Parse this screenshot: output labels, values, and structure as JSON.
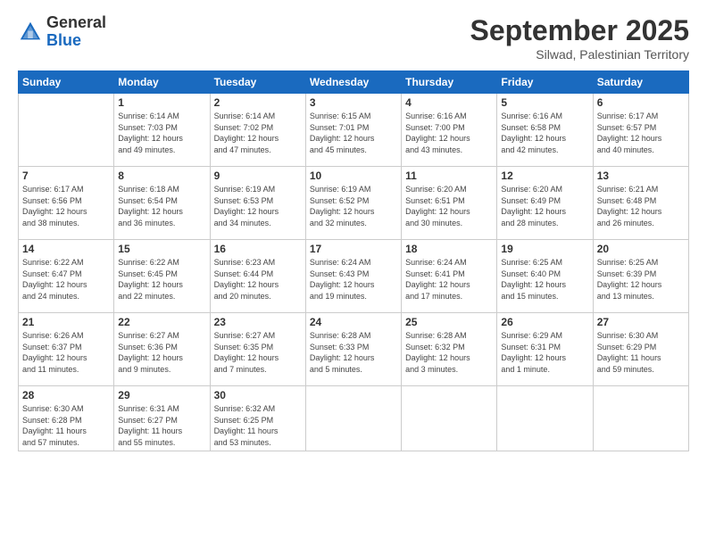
{
  "logo": {
    "general": "General",
    "blue": "Blue"
  },
  "header": {
    "month": "September 2025",
    "location": "Silwad, Palestinian Territory"
  },
  "days_of_week": [
    "Sunday",
    "Monday",
    "Tuesday",
    "Wednesday",
    "Thursday",
    "Friday",
    "Saturday"
  ],
  "weeks": [
    [
      {
        "day": "",
        "info": ""
      },
      {
        "day": "1",
        "info": "Sunrise: 6:14 AM\nSunset: 7:03 PM\nDaylight: 12 hours\nand 49 minutes."
      },
      {
        "day": "2",
        "info": "Sunrise: 6:14 AM\nSunset: 7:02 PM\nDaylight: 12 hours\nand 47 minutes."
      },
      {
        "day": "3",
        "info": "Sunrise: 6:15 AM\nSunset: 7:01 PM\nDaylight: 12 hours\nand 45 minutes."
      },
      {
        "day": "4",
        "info": "Sunrise: 6:16 AM\nSunset: 7:00 PM\nDaylight: 12 hours\nand 43 minutes."
      },
      {
        "day": "5",
        "info": "Sunrise: 6:16 AM\nSunset: 6:58 PM\nDaylight: 12 hours\nand 42 minutes."
      },
      {
        "day": "6",
        "info": "Sunrise: 6:17 AM\nSunset: 6:57 PM\nDaylight: 12 hours\nand 40 minutes."
      }
    ],
    [
      {
        "day": "7",
        "info": "Sunrise: 6:17 AM\nSunset: 6:56 PM\nDaylight: 12 hours\nand 38 minutes."
      },
      {
        "day": "8",
        "info": "Sunrise: 6:18 AM\nSunset: 6:54 PM\nDaylight: 12 hours\nand 36 minutes."
      },
      {
        "day": "9",
        "info": "Sunrise: 6:19 AM\nSunset: 6:53 PM\nDaylight: 12 hours\nand 34 minutes."
      },
      {
        "day": "10",
        "info": "Sunrise: 6:19 AM\nSunset: 6:52 PM\nDaylight: 12 hours\nand 32 minutes."
      },
      {
        "day": "11",
        "info": "Sunrise: 6:20 AM\nSunset: 6:51 PM\nDaylight: 12 hours\nand 30 minutes."
      },
      {
        "day": "12",
        "info": "Sunrise: 6:20 AM\nSunset: 6:49 PM\nDaylight: 12 hours\nand 28 minutes."
      },
      {
        "day": "13",
        "info": "Sunrise: 6:21 AM\nSunset: 6:48 PM\nDaylight: 12 hours\nand 26 minutes."
      }
    ],
    [
      {
        "day": "14",
        "info": "Sunrise: 6:22 AM\nSunset: 6:47 PM\nDaylight: 12 hours\nand 24 minutes."
      },
      {
        "day": "15",
        "info": "Sunrise: 6:22 AM\nSunset: 6:45 PM\nDaylight: 12 hours\nand 22 minutes."
      },
      {
        "day": "16",
        "info": "Sunrise: 6:23 AM\nSunset: 6:44 PM\nDaylight: 12 hours\nand 20 minutes."
      },
      {
        "day": "17",
        "info": "Sunrise: 6:24 AM\nSunset: 6:43 PM\nDaylight: 12 hours\nand 19 minutes."
      },
      {
        "day": "18",
        "info": "Sunrise: 6:24 AM\nSunset: 6:41 PM\nDaylight: 12 hours\nand 17 minutes."
      },
      {
        "day": "19",
        "info": "Sunrise: 6:25 AM\nSunset: 6:40 PM\nDaylight: 12 hours\nand 15 minutes."
      },
      {
        "day": "20",
        "info": "Sunrise: 6:25 AM\nSunset: 6:39 PM\nDaylight: 12 hours\nand 13 minutes."
      }
    ],
    [
      {
        "day": "21",
        "info": "Sunrise: 6:26 AM\nSunset: 6:37 PM\nDaylight: 12 hours\nand 11 minutes."
      },
      {
        "day": "22",
        "info": "Sunrise: 6:27 AM\nSunset: 6:36 PM\nDaylight: 12 hours\nand 9 minutes."
      },
      {
        "day": "23",
        "info": "Sunrise: 6:27 AM\nSunset: 6:35 PM\nDaylight: 12 hours\nand 7 minutes."
      },
      {
        "day": "24",
        "info": "Sunrise: 6:28 AM\nSunset: 6:33 PM\nDaylight: 12 hours\nand 5 minutes."
      },
      {
        "day": "25",
        "info": "Sunrise: 6:28 AM\nSunset: 6:32 PM\nDaylight: 12 hours\nand 3 minutes."
      },
      {
        "day": "26",
        "info": "Sunrise: 6:29 AM\nSunset: 6:31 PM\nDaylight: 12 hours\nand 1 minute."
      },
      {
        "day": "27",
        "info": "Sunrise: 6:30 AM\nSunset: 6:29 PM\nDaylight: 11 hours\nand 59 minutes."
      }
    ],
    [
      {
        "day": "28",
        "info": "Sunrise: 6:30 AM\nSunset: 6:28 PM\nDaylight: 11 hours\nand 57 minutes."
      },
      {
        "day": "29",
        "info": "Sunrise: 6:31 AM\nSunset: 6:27 PM\nDaylight: 11 hours\nand 55 minutes."
      },
      {
        "day": "30",
        "info": "Sunrise: 6:32 AM\nSunset: 6:25 PM\nDaylight: 11 hours\nand 53 minutes."
      },
      {
        "day": "",
        "info": ""
      },
      {
        "day": "",
        "info": ""
      },
      {
        "day": "",
        "info": ""
      },
      {
        "day": "",
        "info": ""
      }
    ]
  ]
}
